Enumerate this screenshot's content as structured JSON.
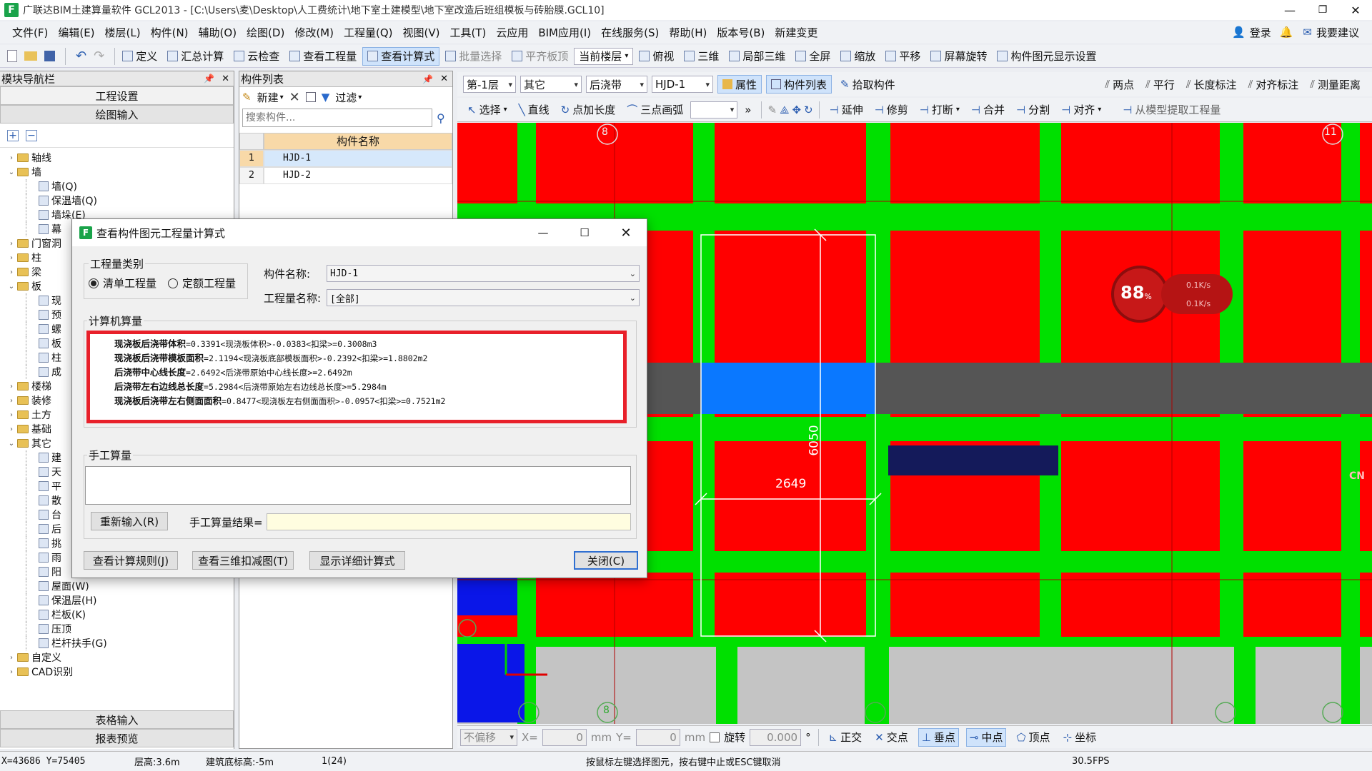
{
  "window": {
    "title": "广联达BIM土建算量软件 GCL2013 - [C:\\Users\\麦\\Desktop\\人工费统计\\地下室土建模型\\地下室改造后班组模板与砖胎膜.GCL10]"
  },
  "menu": [
    "文件(F)",
    "编辑(E)",
    "楼层(L)",
    "构件(N)",
    "辅助(O)",
    "绘图(D)",
    "修改(M)",
    "工程量(Q)",
    "视图(V)",
    "工具(T)",
    "云应用",
    "BIM应用(I)",
    "在线服务(S)",
    "帮助(H)",
    "版本号(B)",
    "新建变更"
  ],
  "menu_right": {
    "login": "登录",
    "suggest": "我要建议"
  },
  "toolbar1": [
    "定义",
    "汇总计算",
    "云检查",
    "查看工程量",
    "查看计算式",
    "批量选择",
    "平齐板顶",
    "当前楼层",
    "俯视",
    "三维",
    "局部三维",
    "全屏",
    "缩放",
    "平移",
    "屏幕旋转",
    "构件图元显示设置"
  ],
  "left_panel": {
    "title": "模块导航栏",
    "tabs": [
      "工程设置",
      "绘图输入"
    ],
    "tree": [
      {
        "label": "轴线",
        "level": 0,
        "type": "folder",
        "exp": "›"
      },
      {
        "label": "墙",
        "level": 0,
        "type": "folder",
        "exp": "⌄"
      },
      {
        "label": "墙(Q)",
        "level": 1,
        "type": "leaf"
      },
      {
        "label": "保温墙(Q)",
        "level": 1,
        "type": "leaf"
      },
      {
        "label": "墙垛(E)",
        "level": 1,
        "type": "leaf"
      },
      {
        "label": "幕",
        "level": 1,
        "type": "leaf"
      },
      {
        "label": "门窗洞",
        "level": 0,
        "type": "folder",
        "exp": "›"
      },
      {
        "label": "柱",
        "level": 0,
        "type": "folder",
        "exp": "›"
      },
      {
        "label": "梁",
        "level": 0,
        "type": "folder",
        "exp": "›"
      },
      {
        "label": "板",
        "level": 0,
        "type": "folder",
        "exp": "⌄"
      },
      {
        "label": "现",
        "level": 1,
        "type": "leaf"
      },
      {
        "label": "预",
        "level": 1,
        "type": "leaf"
      },
      {
        "label": "螺",
        "level": 1,
        "type": "leaf"
      },
      {
        "label": "板",
        "level": 1,
        "type": "leaf"
      },
      {
        "label": "柱",
        "level": 1,
        "type": "leaf"
      },
      {
        "label": "成",
        "level": 1,
        "type": "leaf"
      },
      {
        "label": "楼梯",
        "level": 0,
        "type": "folder",
        "exp": "›"
      },
      {
        "label": "装修",
        "level": 0,
        "type": "folder",
        "exp": "›"
      },
      {
        "label": "土方",
        "level": 0,
        "type": "folder",
        "exp": "›"
      },
      {
        "label": "基础",
        "level": 0,
        "type": "folder",
        "exp": "›"
      },
      {
        "label": "其它",
        "level": 0,
        "type": "folder",
        "exp": "⌄"
      },
      {
        "label": "建",
        "level": 1,
        "type": "leaf"
      },
      {
        "label": "天",
        "level": 1,
        "type": "leaf"
      },
      {
        "label": "平",
        "level": 1,
        "type": "leaf"
      },
      {
        "label": "散",
        "level": 1,
        "type": "leaf"
      },
      {
        "label": "台",
        "level": 1,
        "type": "leaf"
      },
      {
        "label": "后",
        "level": 1,
        "type": "leaf"
      },
      {
        "label": "挑",
        "level": 1,
        "type": "leaf"
      },
      {
        "label": "雨",
        "level": 1,
        "type": "leaf"
      },
      {
        "label": "阳",
        "level": 1,
        "type": "leaf"
      },
      {
        "label": "屋面(W)",
        "level": 1,
        "type": "leaf"
      },
      {
        "label": "保温层(H)",
        "level": 1,
        "type": "leaf"
      },
      {
        "label": "栏板(K)",
        "level": 1,
        "type": "leaf"
      },
      {
        "label": "压顶",
        "level": 1,
        "type": "leaf"
      },
      {
        "label": "栏杆扶手(G)",
        "level": 1,
        "type": "leaf"
      },
      {
        "label": "自定义",
        "level": 0,
        "type": "folder",
        "exp": "›"
      },
      {
        "label": "CAD识别",
        "level": 0,
        "type": "folder",
        "exp": "›"
      }
    ],
    "bottom_tabs": [
      "表格输入",
      "报表预览"
    ]
  },
  "component_list": {
    "title": "构件列表",
    "new_label": "新建",
    "filter_label": "过滤",
    "search_placeholder": "搜索构件...",
    "header": "构件名称",
    "rows": [
      {
        "no": "1",
        "name": "HJD-1"
      },
      {
        "no": "2",
        "name": "HJD-2"
      }
    ]
  },
  "draw_toolbar": {
    "floor": "第-1层",
    "category": "其它",
    "type": "后浇带",
    "component": "HJD-1",
    "props": "属性",
    "list": "构件列表",
    "pick": "拾取构件",
    "right_tools": [
      "两点",
      "平行",
      "长度标注",
      "对齐标注",
      "测量距离"
    ],
    "row2": [
      "选择",
      "直线",
      "点加长度",
      "三点画弧"
    ],
    "row2_right": [
      "延伸",
      "修剪",
      "打断",
      "合并",
      "分割",
      "对齐",
      "从模型提取工程量"
    ]
  },
  "canvas": {
    "axis_top": [
      "8",
      "11"
    ],
    "axis_bottom": [
      "8"
    ],
    "dim_vertical": "6050",
    "dim_horizontal": "2649",
    "gauge_value": "88",
    "gauge_unit": "%",
    "speed_up": "0.1K/s",
    "speed_down": "0.1K/s",
    "edge_label": "CN"
  },
  "dialog": {
    "title": "查看构件图元工程量计算式",
    "qty_type_label": "工程量类别",
    "radio1": "清单工程量",
    "radio2": "定额工程量",
    "comp_name_label": "构件名称:",
    "comp_name_value": "HJD-1",
    "qty_name_label": "工程量名称:",
    "qty_name_value": "[全部]",
    "computer_label": "计算机算量",
    "formulas": [
      {
        "name": "现浇板后浇带体积",
        "expr": "=0.3391<现浇板体积>-0.0383<扣梁>=0.3008m3"
      },
      {
        "name": "现浇板后浇带模板面积",
        "expr": "=2.1194<现浇板底部模板面积>-0.2392<扣梁>=1.8802m2"
      },
      {
        "name": "后浇带中心线长度",
        "expr": "=2.6492<后浇带原始中心线长度>=2.6492m"
      },
      {
        "name": "后浇带左右边线总长度",
        "expr": "=5.2984<后浇带原始左右边线总长度>=5.2984m"
      },
      {
        "name": "现浇板后浇带左右侧面面积",
        "expr": "=0.8477<现浇板左右侧面面积>-0.0957<扣梁>=0.7521m2"
      }
    ],
    "manual_label": "手工算量",
    "reinput": "重新输入(R)",
    "manual_result_label": "手工算量结果=",
    "btn_rules": "查看计算规则(J)",
    "btn_3d": "查看三维扣减图(T)",
    "btn_detail": "显示详细计算式",
    "btn_close": "关闭(C)"
  },
  "snap_bar": {
    "offset": "不偏移",
    "x_label": "X=",
    "x_value": "0",
    "mm1": "mm",
    "y_label": "Y=",
    "y_value": "0",
    "mm2": "mm",
    "rotate": "旋转",
    "rotate_value": "0.000",
    "deg": "°",
    "snaps": [
      "正交",
      "交点",
      "垂点",
      "中点",
      "顶点",
      "坐标"
    ]
  },
  "status_bar": {
    "coords": "X=43686 Y=75405",
    "floor_height": "层高:3.6m",
    "base_elev": "建筑底标高:-5m",
    "count": "1(24)",
    "hint": "按鼠标左键选择图元，按右键中止或ESC键取消",
    "fps": "30.5FPS"
  },
  "colors": {
    "accent": "#2f6fd1",
    "highlight_border": "#e8202a",
    "slab": "#ff0000",
    "beam": "#00e000",
    "post_pour": "#0a78ff",
    "band": "#555555"
  }
}
